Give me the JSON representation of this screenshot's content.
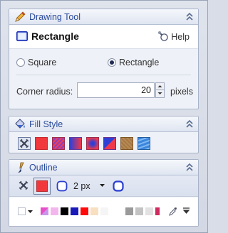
{
  "drawing_panel": {
    "title": "Drawing Tool",
    "tool_name": "Rectangle",
    "help_label": "Help",
    "shape_options": [
      {
        "label": "Square",
        "selected": false
      },
      {
        "label": "Rectangle",
        "selected": true
      }
    ],
    "corner_radius_label": "Corner radius:",
    "corner_radius_value": "20",
    "corner_radius_unit": "pixels"
  },
  "fill_panel": {
    "title": "Fill Style",
    "styles": [
      {
        "name": "no-fill",
        "color": "#5a6275"
      },
      {
        "name": "solid",
        "color": "#f1383d"
      },
      {
        "name": "hatch",
        "color": "#ec3a63"
      },
      {
        "name": "linear-gradient",
        "color": "#6e49c4"
      },
      {
        "name": "radial-gradient",
        "color": "#d2347d"
      },
      {
        "name": "two-color",
        "color": "#8a45c0"
      },
      {
        "name": "pattern",
        "color": "#b28350"
      },
      {
        "name": "texture",
        "color": "#3a82d6"
      }
    ]
  },
  "outline_panel": {
    "title": "Outline",
    "stroke_color": "#f1383d",
    "width_value": "2 px",
    "palette": [
      "#ffffff",
      "#e64fc7",
      "#f3b6ec",
      "#000000",
      "#1a1ab8",
      "#ff0a0a",
      "#f7dfbf",
      "#f5f5f5",
      "#9a9a9a",
      "#c3c3c3",
      "#e2e2e2",
      "#cf2b5e"
    ]
  },
  "colors": {
    "header_text": "#2a4b9b",
    "accent_blue": "#2b3fd1"
  }
}
